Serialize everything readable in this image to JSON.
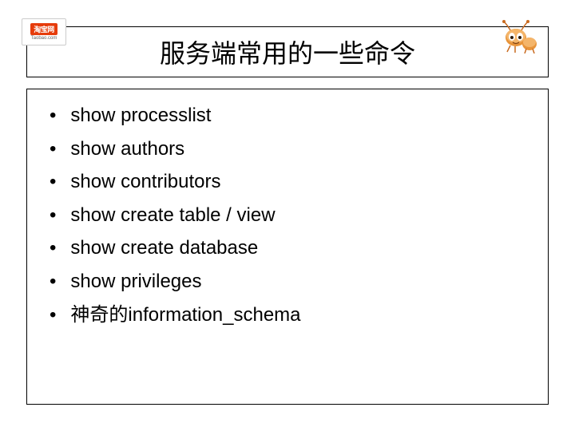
{
  "logo": {
    "text_top": "淘宝网",
    "text_bottom": "Taobao.com"
  },
  "title": "服务端常用的一些命令",
  "bullets": [
    "show processlist",
    "show authors",
    "show  contributors",
    "show create table / view",
    "show create database",
    "show privileges",
    "神奇的information_schema"
  ]
}
